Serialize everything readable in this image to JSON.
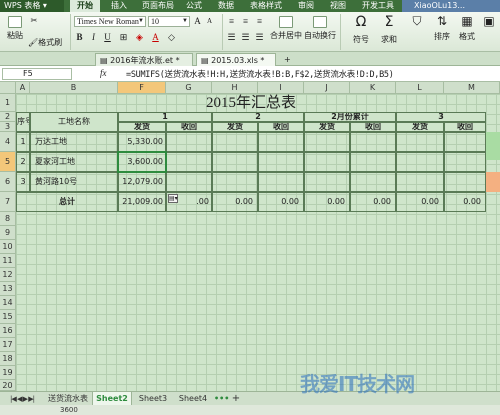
{
  "app": {
    "name": "WPS 表格",
    "user": "XiaoOLu13..."
  },
  "ribbon_tabs": [
    "开始",
    "插入",
    "页面布局",
    "公式",
    "数据",
    "表格样式",
    "审阅",
    "视图",
    "开发工具"
  ],
  "toolbar": {
    "paste": "粘贴",
    "format_painter": "格式刷",
    "font_name": "Times New Roman",
    "font_size": "10",
    "merge_center": "合并居中",
    "auto_wrap": "自动换行",
    "symbol": "符号",
    "sum": "求和",
    "sort": "排序",
    "format": "格式",
    "style": "样式"
  },
  "doc_tabs": [
    "2016年流水账.et *",
    "2015.03.xls *"
  ],
  "formula_bar": {
    "name_box": "F5",
    "fx": "fx",
    "formula": "=SUMIFS(送货流水表!H:H,送货流水表!B:B,F$2,送货流水表!D:D,B5)"
  },
  "columns": [
    "A",
    "B",
    "F",
    "G",
    "H",
    "I",
    "J",
    "K",
    "L",
    "M"
  ],
  "rows": [
    "1",
    "2",
    "3",
    "4",
    "5",
    "6",
    "7",
    "8",
    "9",
    "10",
    "11",
    "12",
    "13",
    "14",
    "15",
    "16",
    "17",
    "18",
    "19",
    "20"
  ],
  "sheet": {
    "title": "2015年汇总表",
    "header": {
      "seq": "序号",
      "site": "工地名称",
      "month1": "1",
      "month2": "2",
      "month2_cum": "2月份累计",
      "month3": "3",
      "send": "发货",
      "receive": "收回"
    },
    "data_rows": [
      {
        "seq": "1",
        "site": "万达工地",
        "send": "5,330.00"
      },
      {
        "seq": "2",
        "site": "夏家河工地",
        "send": "3,600.00"
      },
      {
        "seq": "3",
        "site": "黄河路10号",
        "send": "12,079.00"
      }
    ],
    "total": {
      "label": "总计",
      "values": [
        "21,009.00",
        ".00",
        "0.00",
        "0.00",
        "0.00",
        "0.00",
        "0.00",
        "0.00"
      ]
    }
  },
  "sheet_tabs": [
    "送货流水表",
    "Sheet2",
    "Sheet3",
    "Sheet4"
  ],
  "active_sheet": "Sheet2",
  "status_value": "3600",
  "watermark": "我爱IT技术网"
}
